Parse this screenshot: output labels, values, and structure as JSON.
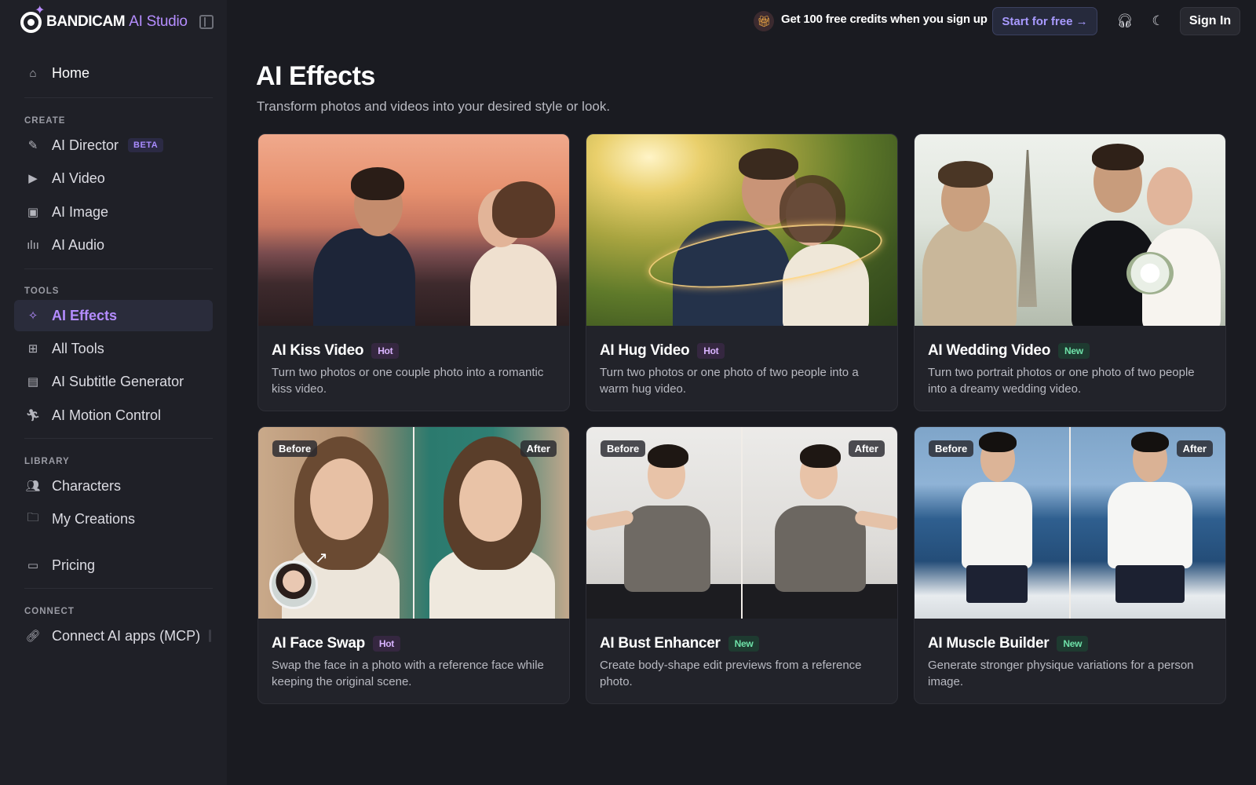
{
  "brand": {
    "name": "BANDICAM",
    "product": "AI Studio"
  },
  "header": {
    "promo_text": "Get 100 free credits when you sign up",
    "start_label": "Start for free →",
    "signin_label": "Sign In"
  },
  "sidebar": {
    "home": "Home",
    "sections": {
      "create": "CREATE",
      "tools": "TOOLS",
      "library": "LIBRARY",
      "connect": "CONNECT"
    },
    "create_items": [
      {
        "label": "AI Director",
        "badge": "BETA"
      },
      {
        "label": "AI Video"
      },
      {
        "label": "AI Image"
      },
      {
        "label": "AI Audio"
      }
    ],
    "tools_items": [
      {
        "label": "AI Effects",
        "active": true
      },
      {
        "label": "All Tools"
      },
      {
        "label": "AI Subtitle Generator"
      },
      {
        "label": "AI Motion Control"
      }
    ],
    "library_items": [
      {
        "label": "Characters"
      },
      {
        "label": "My Creations"
      }
    ],
    "pricing": "Pricing",
    "connect_items": [
      {
        "label": "Connect AI apps (MCP)"
      }
    ]
  },
  "main": {
    "title": "AI Effects",
    "subtitle": "Transform photos and videos into your desired style or look.",
    "before_label": "Before",
    "after_label": "After",
    "cards": [
      {
        "title": "AI Kiss Video",
        "badge": "Hot",
        "desc": "Turn two photos or one couple photo into a romantic kiss video."
      },
      {
        "title": "AI Hug Video",
        "badge": "Hot",
        "desc": "Turn two photos or one photo of two people into a warm hug video."
      },
      {
        "title": "AI Wedding Video",
        "badge": "New",
        "desc": "Turn two portrait photos or one photo of two people into a dreamy wedding video."
      },
      {
        "title": "AI Face Swap",
        "badge": "Hot",
        "desc": "Swap the face in a photo with a reference face while keeping the original scene."
      },
      {
        "title": "AI Bust Enhancer",
        "badge": "New",
        "desc": "Create body-shape edit previews from a reference photo."
      },
      {
        "title": "AI Muscle Builder",
        "badge": "New",
        "desc": "Generate stronger physique variations for a person image."
      }
    ]
  },
  "colors": {
    "accent": "#b48cff",
    "background": "#1a1b21",
    "sidebar": "#1f2027",
    "hot_badge": "#d9b4ff",
    "new_badge": "#6ee1a8"
  }
}
